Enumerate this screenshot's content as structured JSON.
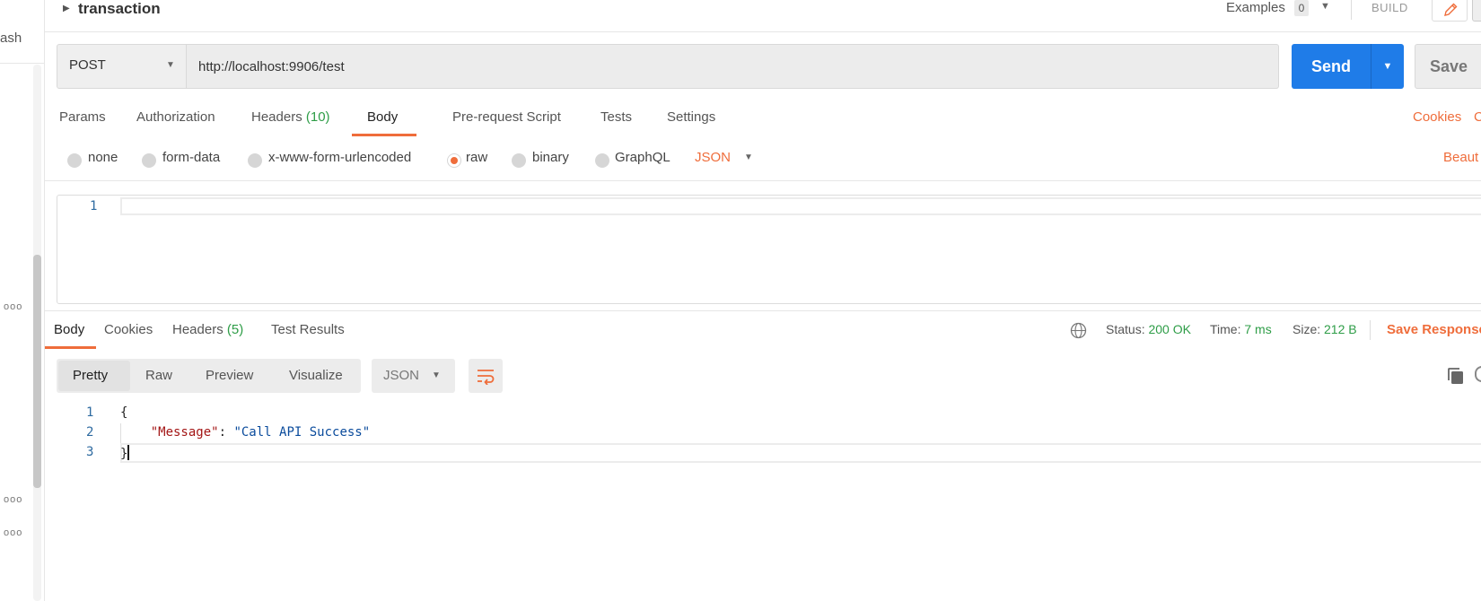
{
  "sidebar": {
    "partial_label": "ash",
    "more_dots": "ooo"
  },
  "topbar": {
    "request_name": "transaction",
    "examples_label": "Examples",
    "examples_count": "0",
    "build_label": "BUILD"
  },
  "request": {
    "method": "POST",
    "url": "http://localhost:9906/test",
    "send_label": "Send",
    "save_label": "Save"
  },
  "request_tabs": {
    "params": "Params",
    "authorization": "Authorization",
    "headers": "Headers",
    "headers_count": "(10)",
    "body": "Body",
    "prerequest": "Pre-request Script",
    "tests": "Tests",
    "settings": "Settings",
    "cookies": "Cookies",
    "code_partial": "C"
  },
  "body_types": {
    "none": "none",
    "form_data": "form-data",
    "urlencoded": "x-www-form-urlencoded",
    "raw": "raw",
    "binary": "binary",
    "graphql": "GraphQL",
    "language": "JSON",
    "beautify_partial": "Beaut"
  },
  "request_editor": {
    "line_number": "1"
  },
  "response_tabs": {
    "body": "Body",
    "cookies": "Cookies",
    "headers": "Headers",
    "headers_count": "(5)",
    "test_results": "Test Results",
    "status_label": "Status:",
    "status_value": "200 OK",
    "time_label": "Time:",
    "time_value": "7 ms",
    "size_label": "Size:",
    "size_value": "212 B",
    "save_response": "Save Response"
  },
  "response_toolbar": {
    "pretty": "Pretty",
    "raw": "Raw",
    "preview": "Preview",
    "visualize": "Visualize",
    "format": "JSON"
  },
  "response_code": {
    "lines": [
      {
        "num": "1",
        "text": "{"
      },
      {
        "num": "2",
        "indent": "    ",
        "key": "\"Message\"",
        "sep": ": ",
        "value": "\"Call API Success\""
      },
      {
        "num": "3",
        "text": "}"
      }
    ]
  },
  "colors": {
    "accent": "#ef6d3b",
    "primary": "#1f7ce8",
    "success": "#2e9d47"
  }
}
